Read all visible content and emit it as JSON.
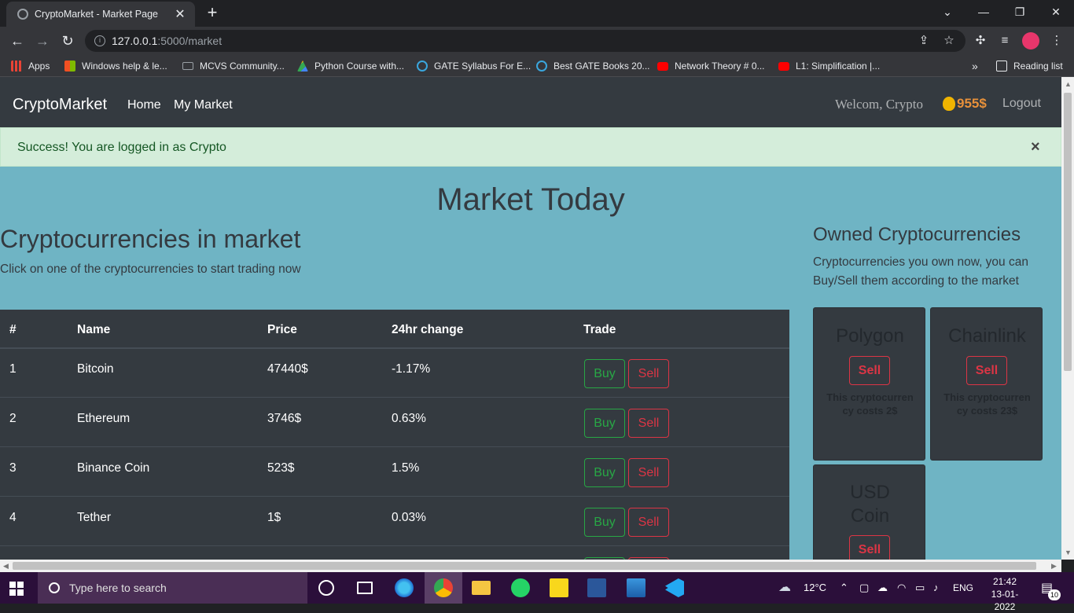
{
  "browser": {
    "tab_title": "CryptoMarket - Market Page",
    "url_host": "127.0.0.1",
    "url_path": ":5000/market",
    "bookmarks": [
      {
        "label": "Apps",
        "color": "#ea4335"
      },
      {
        "label": "Windows help & le...",
        "color": "#f25022"
      },
      {
        "label": "MCVS Community...",
        "color": "#9aa0a6"
      },
      {
        "label": "Python Course with...",
        "color": "#fbbc04"
      },
      {
        "label": "GATE Syllabus For E...",
        "color": "#3aa6dd"
      },
      {
        "label": "Best GATE Books 20...",
        "color": "#3aa6dd"
      },
      {
        "label": "Network Theory # 0...",
        "color": "#ff0000"
      },
      {
        "label": "L1: Simplification |...",
        "color": "#ff0000"
      }
    ],
    "bookmarks_more": "»",
    "reading_list": "Reading list"
  },
  "navbar": {
    "brand": "CryptoMarket",
    "links": [
      "Home",
      "My Market"
    ],
    "welcome": "Welcom, Crypto",
    "balance": "955$",
    "logout": "Logout"
  },
  "alert": {
    "message": "Success! You are logged in as Crypto",
    "close": "×"
  },
  "main": {
    "title": "Market Today",
    "left_heading": "Cryptocurrencies in market",
    "left_subtitle": "Click on one of the cryptocurrencies to start trading now",
    "table_headers": [
      "#",
      "Name",
      "Price",
      "24hr change",
      "Trade"
    ],
    "rows": [
      {
        "num": "1",
        "name": "Bitcoin",
        "price": "47440$",
        "change": "-1.17%"
      },
      {
        "num": "2",
        "name": "Ethereum",
        "price": "3746$",
        "change": "0.63%"
      },
      {
        "num": "3",
        "name": "Binance Coin",
        "price": "523$",
        "change": "1.5%"
      },
      {
        "num": "4",
        "name": "Tether",
        "price": "1$",
        "change": "0.03%"
      }
    ],
    "buy_label": "Buy",
    "sell_label": "Sell",
    "right_heading": "Owned Cryptocurrencies",
    "right_subtitle": "Cryptocurrencies you own now, you can Buy/Sell them according to the market",
    "owned": [
      {
        "name": "Polygon",
        "sell": "Sell",
        "desc": "This cryptocurrency costs 2$"
      },
      {
        "name": "Chainlink",
        "sell": "Sell",
        "desc": "This cryptocurrency costs 23$"
      },
      {
        "name": "USD Coin",
        "sell": "Sell"
      }
    ]
  },
  "taskbar": {
    "search_placeholder": "Type here to search",
    "weather": "12°C",
    "language": "ENG",
    "time": "21:42",
    "date": "13-01-2022",
    "notifications": "10"
  }
}
